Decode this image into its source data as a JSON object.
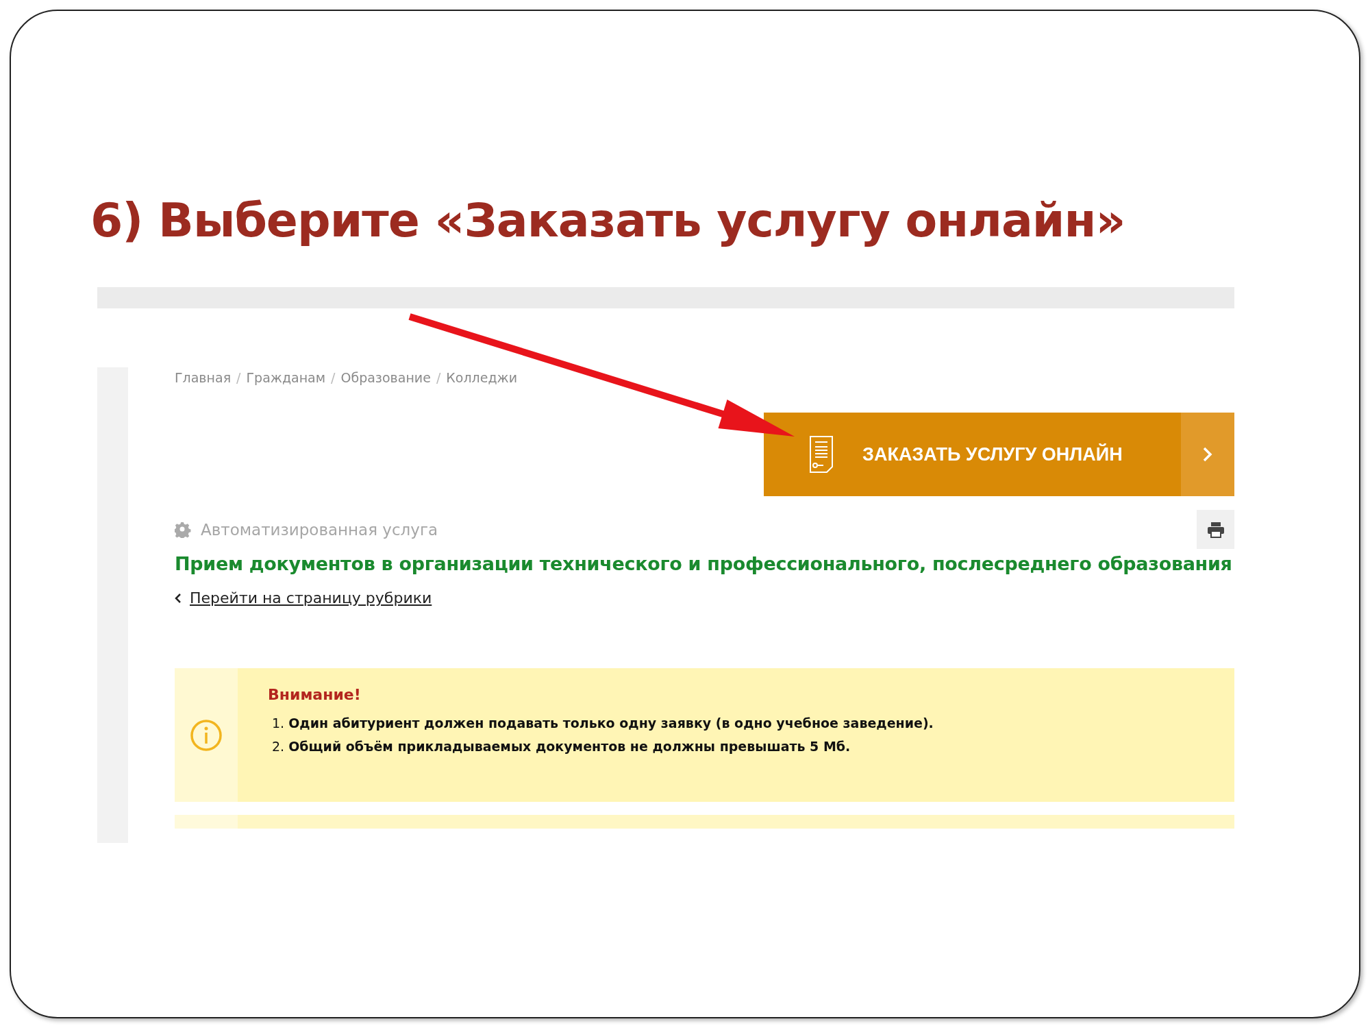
{
  "slide_title": "6) Выберите «Заказать услугу онлайн»",
  "breadcrumbs": [
    "Главная",
    "Гражданам",
    "Образование",
    "Колледжи"
  ],
  "breadcrumb_separator": "/",
  "order_button": {
    "label": "ЗАКАЗАТЬ УСЛУГУ ОНЛАЙН"
  },
  "service_type": "Автоматизированная услуга",
  "service_title": "Прием документов в организации технического и профессионального, послесреднего образования",
  "back_link": "Перейти на страницу рубрики",
  "notice": {
    "title": "Внимание!",
    "items": [
      {
        "number": "1.",
        "text": "Один абитуриент должен подавать только одну заявку (в одно учебное заведение)."
      },
      {
        "number": "2.",
        "text": "Общий объём прикладываемых документов не должны превышать 5 Мб."
      }
    ]
  }
}
